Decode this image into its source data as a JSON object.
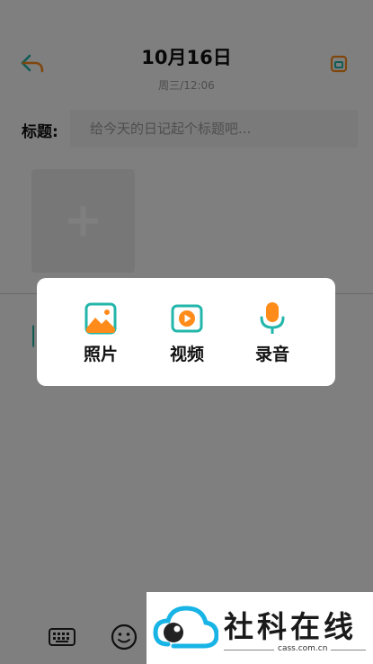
{
  "header": {
    "date_title": "10月16日",
    "date_subtitle": "周三/12:06",
    "back_icon": "back-arrow-icon",
    "save_icon": "save-icon"
  },
  "form": {
    "title_label": "标题:",
    "title_placeholder": "给今天的日记起个标题吧...",
    "add_media_icon": "plus-icon",
    "body_text": "|"
  },
  "toolbar": {
    "keyboard_icon": "keyboard-icon",
    "emoji_icon": "emoji-icon"
  },
  "popup": {
    "options": [
      {
        "label": "照片",
        "icon": "photo-icon"
      },
      {
        "label": "视频",
        "icon": "video-icon"
      },
      {
        "label": "录音",
        "icon": "microphone-icon"
      }
    ]
  },
  "watermark": {
    "text": "社科在线",
    "url": "cass.com.cn"
  },
  "colors": {
    "accent_teal": "#23b6aa",
    "accent_orange": "#ff8c1a",
    "overlay": "#000000"
  }
}
